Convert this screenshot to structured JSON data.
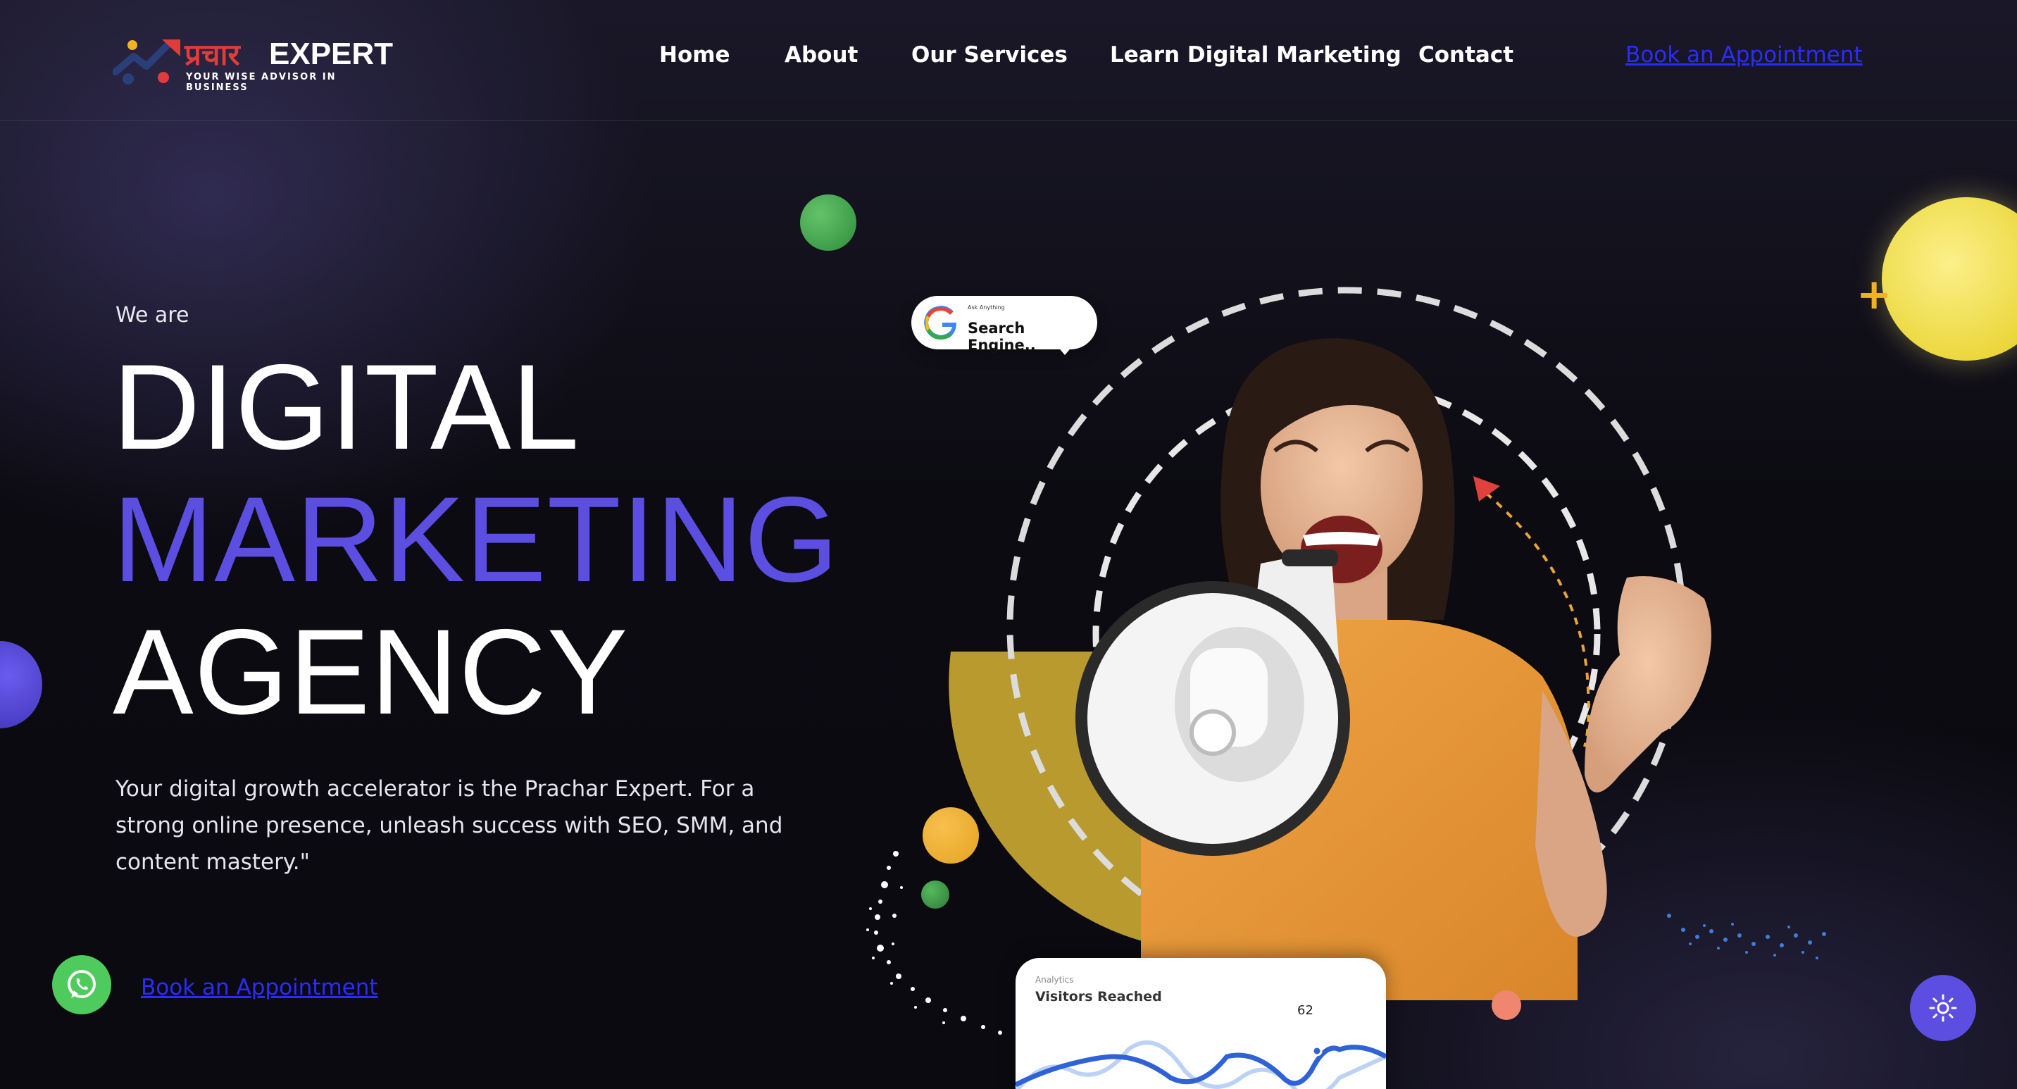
{
  "header": {
    "logo": {
      "hindi": "प्रचार",
      "brand": "EXPERT",
      "tagline": "YOUR WISE ADVISOR IN BUSINESS"
    },
    "nav": {
      "home": "Home",
      "about": "About",
      "services": "Our Services",
      "learn": "Learn Digital Marketing",
      "contact": "Contact",
      "cta": "Book an Appointment"
    }
  },
  "hero": {
    "intro": "We are",
    "line1": "DIGITAL",
    "line2": "MARKETING",
    "line3": "AGENCY",
    "description": "Your digital growth accelerator is the Prachar Expert. For a strong online presence, unleash success with SEO, SMM, and content mastery.\"",
    "cta": "Book an Appointment"
  },
  "search_bubble": {
    "ask": "Ask Anything",
    "text": "Search Engine.."
  },
  "analytics_card": {
    "label": "Analytics",
    "title": "Visitors Reached",
    "peak_value": "62"
  },
  "colors": {
    "accent": "#5b4ee0",
    "link": "#2b2bff",
    "whatsapp": "#4ecb5c",
    "background": "#0d0c14"
  },
  "icons": {
    "whatsapp": "whatsapp-icon",
    "theme": "sun-icon",
    "search": "google-icon"
  }
}
